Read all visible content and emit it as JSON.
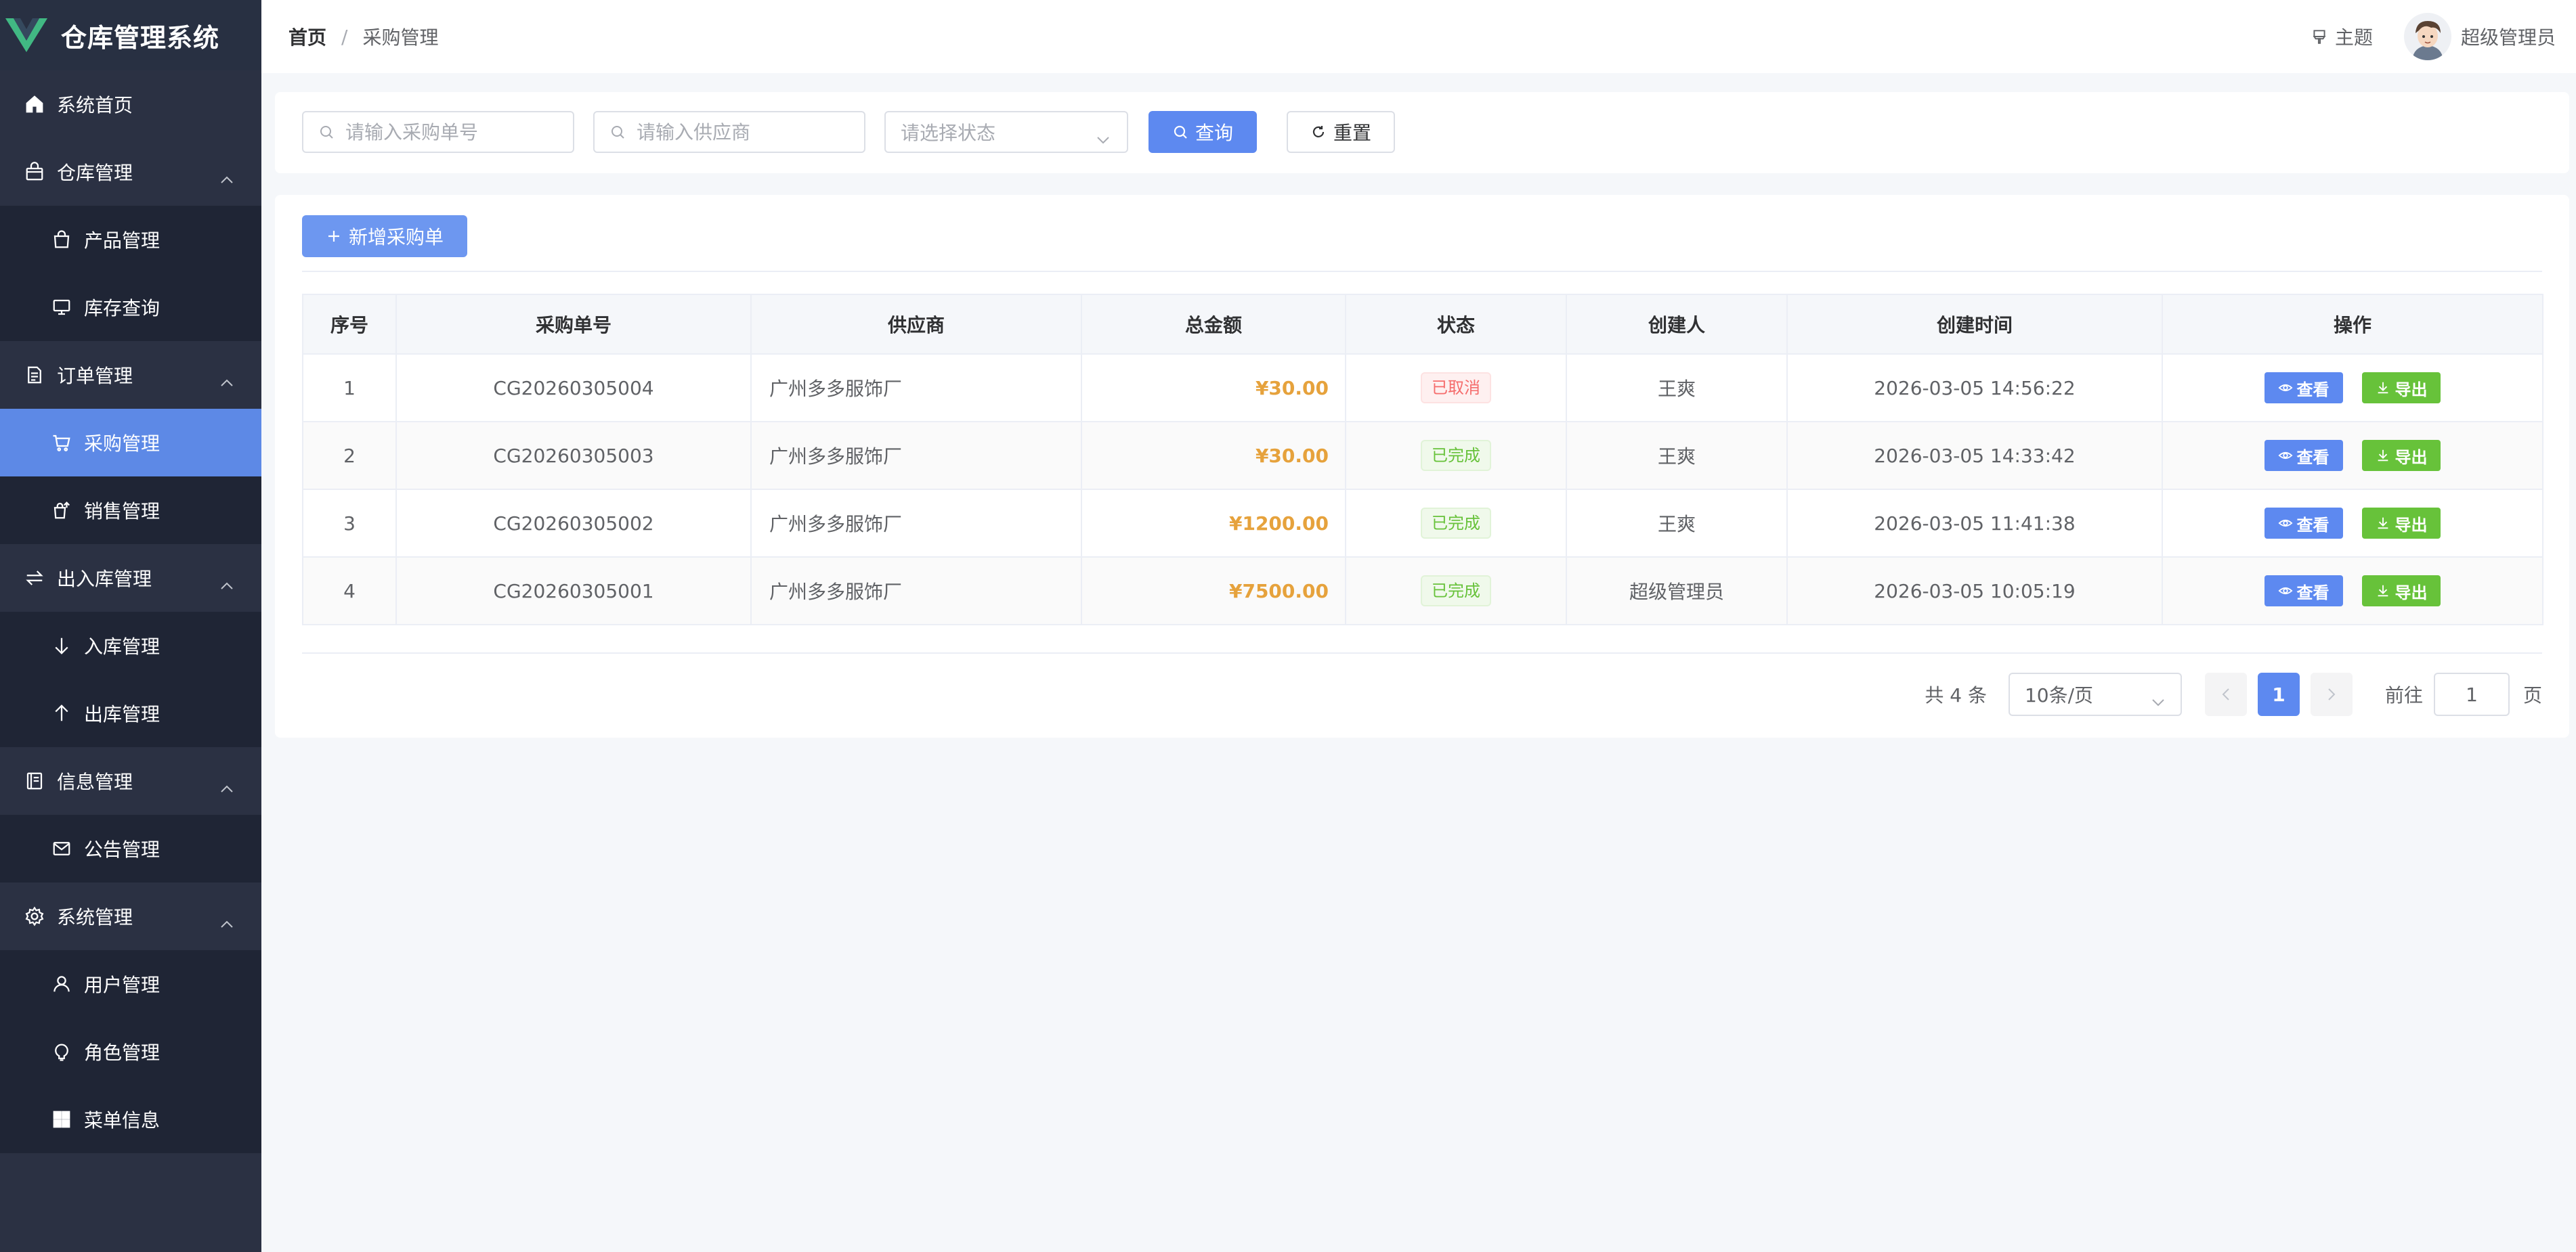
{
  "app": {
    "title": "仓库管理系统",
    "brand_color": "#41b883"
  },
  "sidebar": {
    "items": [
      {
        "label": "系统首页",
        "icon": "home-icon"
      },
      {
        "label": "仓库管理",
        "icon": "warehouse-icon",
        "expanded": true
      },
      {
        "label": "产品管理",
        "icon": "bag-icon"
      },
      {
        "label": "库存查询",
        "icon": "monitor-icon"
      },
      {
        "label": "订单管理",
        "icon": "document-icon",
        "expanded": true
      },
      {
        "label": "采购管理",
        "icon": "cart-icon",
        "active": true
      },
      {
        "label": "销售管理",
        "icon": "sell-icon"
      },
      {
        "label": "出入库管理",
        "icon": "switch-icon",
        "expanded": true
      },
      {
        "label": "入库管理",
        "icon": "arrow-down-icon"
      },
      {
        "label": "出库管理",
        "icon": "arrow-up-icon"
      },
      {
        "label": "信息管理",
        "icon": "notebook-icon",
        "expanded": true
      },
      {
        "label": "公告管理",
        "icon": "message-icon"
      },
      {
        "label": "系统管理",
        "icon": "gear-icon",
        "expanded": true
      },
      {
        "label": "用户管理",
        "icon": "user-icon"
      },
      {
        "label": "角色管理",
        "icon": "lightbulb-icon"
      },
      {
        "label": "菜单信息",
        "icon": "grid-icon"
      }
    ]
  },
  "header": {
    "breadcrumb_home": "首页",
    "breadcrumb_sep": "/",
    "breadcrumb_current": "采购管理",
    "theme_label": "主题",
    "user_name": "超级管理员"
  },
  "search": {
    "order_no_placeholder": "请输入采购单号",
    "supplier_placeholder": "请输入供应商",
    "status_placeholder": "请选择状态",
    "query_label": "查询",
    "reset_label": "重置"
  },
  "toolbar": {
    "add_label": "新增采购单"
  },
  "table": {
    "headers": [
      "序号",
      "采购单号",
      "供应商",
      "总金额",
      "状态",
      "创建人",
      "创建时间",
      "操作"
    ],
    "view_label": "查看",
    "export_label": "导出",
    "rows": [
      {
        "index": "1",
        "order_no": "CG20260305004",
        "supplier": "广州多多服饰厂",
        "amount": "¥30.00",
        "status": "已取消",
        "status_type": "danger",
        "creator": "王爽",
        "created_at": "2026-03-05 14:56:22"
      },
      {
        "index": "2",
        "order_no": "CG20260305003",
        "supplier": "广州多多服饰厂",
        "amount": "¥30.00",
        "status": "已完成",
        "status_type": "success",
        "creator": "王爽",
        "created_at": "2026-03-05 14:33:42"
      },
      {
        "index": "3",
        "order_no": "CG20260305002",
        "supplier": "广州多多服饰厂",
        "amount": "¥1200.00",
        "status": "已完成",
        "status_type": "success",
        "creator": "王爽",
        "created_at": "2026-03-05 11:41:38"
      },
      {
        "index": "4",
        "order_no": "CG20260305001",
        "supplier": "广州多多服饰厂",
        "amount": "¥7500.00",
        "status": "已完成",
        "status_type": "success",
        "creator": "超级管理员",
        "created_at": "2026-03-05 10:05:19"
      }
    ]
  },
  "pagination": {
    "total_text": "共 4 条",
    "page_size": "10条/页",
    "current_page": "1",
    "goto_label": "前往",
    "goto_value": "1",
    "page_unit": "页"
  },
  "colors": {
    "primary": "#5d89f0",
    "sidebar_bg": "#2b3143",
    "submenu_bg": "#1f2535",
    "success": "#67c23a",
    "danger": "#f56c6c",
    "amount": "#e6a23c"
  }
}
